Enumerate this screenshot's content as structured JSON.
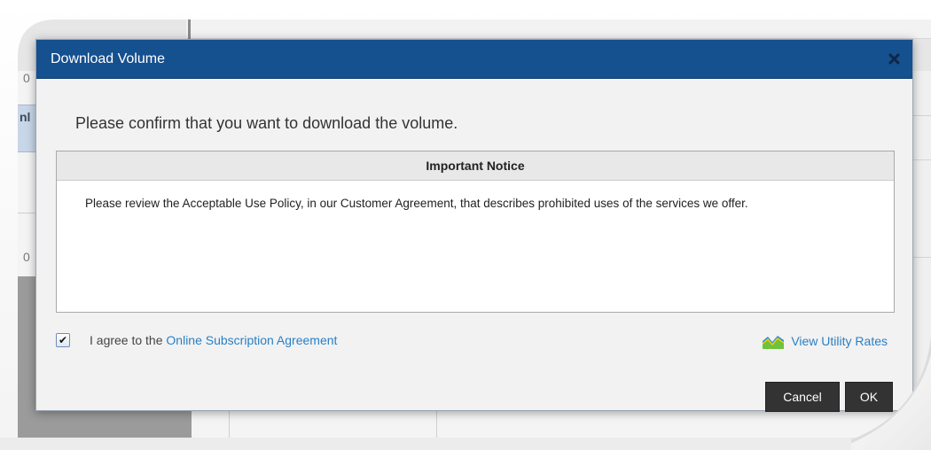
{
  "background": {
    "fragment_1": "0",
    "fragment_2": "nl",
    "fragment_3": "0"
  },
  "dialog": {
    "title": "Download Volume",
    "close_icon": "close-icon",
    "confirm_text": "Please confirm that you want to download the volume.",
    "notice": {
      "header": "Important Notice",
      "body": "Please review the Acceptable Use Policy, in our Customer Agreement, that describes prohibited uses of the services we offer."
    },
    "agreement": {
      "checked": true,
      "check_glyph": "✔",
      "prefix": "I agree to the",
      "link_text": "Online Subscription Agreement"
    },
    "utility": {
      "icon": "chart-area-icon",
      "link_text": "View Utility Rates"
    },
    "buttons": {
      "cancel": "Cancel",
      "ok": "OK"
    }
  },
  "colors": {
    "titlebar": "#15508f",
    "link": "#2a7fc4",
    "button": "#333333"
  }
}
